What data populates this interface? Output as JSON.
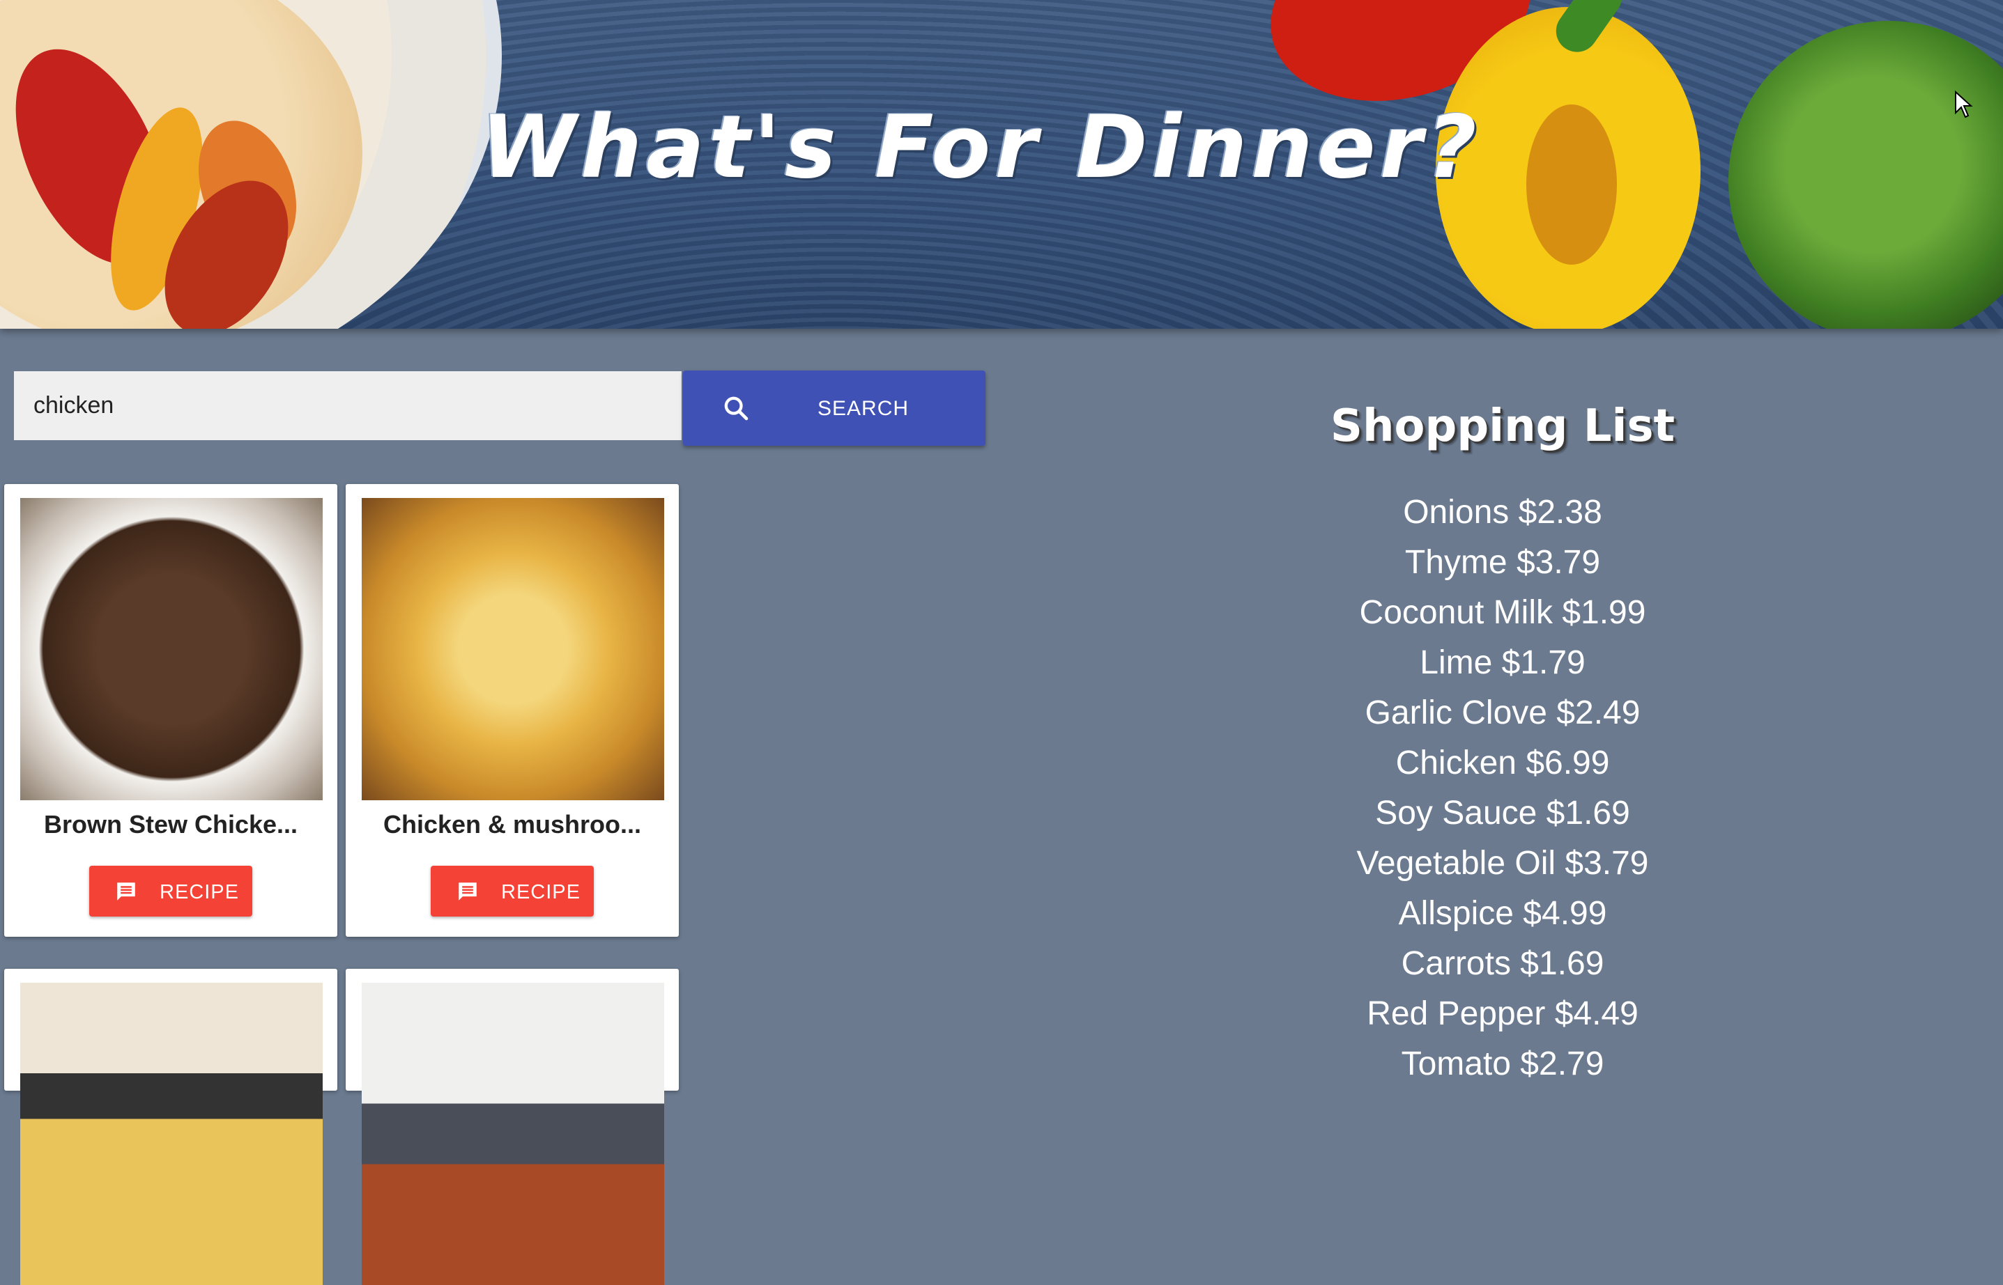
{
  "header": {
    "title": "What's For Dinner?"
  },
  "search": {
    "value": "chicken",
    "placeholder": "",
    "button_label": "SEARCH"
  },
  "recipes": [
    {
      "title": "Brown Stew Chicke...",
      "button_label": "RECIPE"
    },
    {
      "title": "Chicken & mushroo...",
      "button_label": "RECIPE"
    },
    {
      "title": "",
      "button_label": ""
    },
    {
      "title": "",
      "button_label": ""
    }
  ],
  "shopping_list": {
    "title": "Shopping List",
    "items": [
      "Onions $2.38",
      "Thyme $3.79",
      "Coconut Milk $1.99",
      "Lime $1.79",
      "Garlic Clove $2.49",
      "Chicken $6.99",
      "Soy Sauce $1.69",
      "Vegetable Oil $3.79",
      "Allspice $4.99",
      "Carrots $1.69",
      "Red Pepper $4.49",
      "Tomato $2.79"
    ]
  },
  "colors": {
    "background": "#6b7a8f",
    "search_button": "#3f51b5",
    "recipe_button": "#f44336",
    "card": "#ffffff"
  },
  "icons": {
    "search_button": "search-icon",
    "recipe_button": "comment-icon"
  }
}
